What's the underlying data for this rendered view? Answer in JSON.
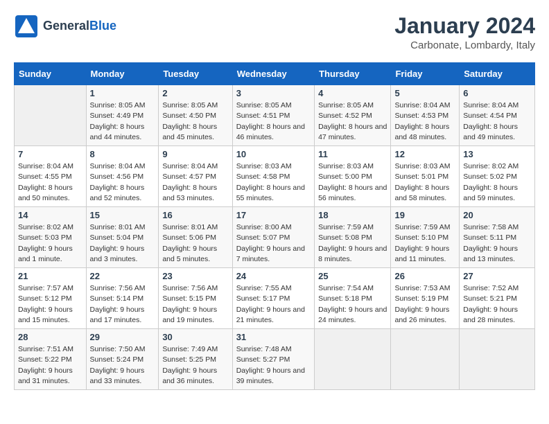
{
  "header": {
    "logo_general": "General",
    "logo_blue": "Blue",
    "month_title": "January 2024",
    "location": "Carbonate, Lombardy, Italy"
  },
  "days_of_week": [
    "Sunday",
    "Monday",
    "Tuesday",
    "Wednesday",
    "Thursday",
    "Friday",
    "Saturday"
  ],
  "weeks": [
    [
      {
        "day": "",
        "sunrise": "",
        "sunset": "",
        "daylight": ""
      },
      {
        "day": "1",
        "sunrise": "Sunrise: 8:05 AM",
        "sunset": "Sunset: 4:49 PM",
        "daylight": "Daylight: 8 hours and 44 minutes."
      },
      {
        "day": "2",
        "sunrise": "Sunrise: 8:05 AM",
        "sunset": "Sunset: 4:50 PM",
        "daylight": "Daylight: 8 hours and 45 minutes."
      },
      {
        "day": "3",
        "sunrise": "Sunrise: 8:05 AM",
        "sunset": "Sunset: 4:51 PM",
        "daylight": "Daylight: 8 hours and 46 minutes."
      },
      {
        "day": "4",
        "sunrise": "Sunrise: 8:05 AM",
        "sunset": "Sunset: 4:52 PM",
        "daylight": "Daylight: 8 hours and 47 minutes."
      },
      {
        "day": "5",
        "sunrise": "Sunrise: 8:04 AM",
        "sunset": "Sunset: 4:53 PM",
        "daylight": "Daylight: 8 hours and 48 minutes."
      },
      {
        "day": "6",
        "sunrise": "Sunrise: 8:04 AM",
        "sunset": "Sunset: 4:54 PM",
        "daylight": "Daylight: 8 hours and 49 minutes."
      }
    ],
    [
      {
        "day": "7",
        "sunrise": "Sunrise: 8:04 AM",
        "sunset": "Sunset: 4:55 PM",
        "daylight": "Daylight: 8 hours and 50 minutes."
      },
      {
        "day": "8",
        "sunrise": "Sunrise: 8:04 AM",
        "sunset": "Sunset: 4:56 PM",
        "daylight": "Daylight: 8 hours and 52 minutes."
      },
      {
        "day": "9",
        "sunrise": "Sunrise: 8:04 AM",
        "sunset": "Sunset: 4:57 PM",
        "daylight": "Daylight: 8 hours and 53 minutes."
      },
      {
        "day": "10",
        "sunrise": "Sunrise: 8:03 AM",
        "sunset": "Sunset: 4:58 PM",
        "daylight": "Daylight: 8 hours and 55 minutes."
      },
      {
        "day": "11",
        "sunrise": "Sunrise: 8:03 AM",
        "sunset": "Sunset: 5:00 PM",
        "daylight": "Daylight: 8 hours and 56 minutes."
      },
      {
        "day": "12",
        "sunrise": "Sunrise: 8:03 AM",
        "sunset": "Sunset: 5:01 PM",
        "daylight": "Daylight: 8 hours and 58 minutes."
      },
      {
        "day": "13",
        "sunrise": "Sunrise: 8:02 AM",
        "sunset": "Sunset: 5:02 PM",
        "daylight": "Daylight: 8 hours and 59 minutes."
      }
    ],
    [
      {
        "day": "14",
        "sunrise": "Sunrise: 8:02 AM",
        "sunset": "Sunset: 5:03 PM",
        "daylight": "Daylight: 9 hours and 1 minute."
      },
      {
        "day": "15",
        "sunrise": "Sunrise: 8:01 AM",
        "sunset": "Sunset: 5:04 PM",
        "daylight": "Daylight: 9 hours and 3 minutes."
      },
      {
        "day": "16",
        "sunrise": "Sunrise: 8:01 AM",
        "sunset": "Sunset: 5:06 PM",
        "daylight": "Daylight: 9 hours and 5 minutes."
      },
      {
        "day": "17",
        "sunrise": "Sunrise: 8:00 AM",
        "sunset": "Sunset: 5:07 PM",
        "daylight": "Daylight: 9 hours and 7 minutes."
      },
      {
        "day": "18",
        "sunrise": "Sunrise: 7:59 AM",
        "sunset": "Sunset: 5:08 PM",
        "daylight": "Daylight: 9 hours and 8 minutes."
      },
      {
        "day": "19",
        "sunrise": "Sunrise: 7:59 AM",
        "sunset": "Sunset: 5:10 PM",
        "daylight": "Daylight: 9 hours and 11 minutes."
      },
      {
        "day": "20",
        "sunrise": "Sunrise: 7:58 AM",
        "sunset": "Sunset: 5:11 PM",
        "daylight": "Daylight: 9 hours and 13 minutes."
      }
    ],
    [
      {
        "day": "21",
        "sunrise": "Sunrise: 7:57 AM",
        "sunset": "Sunset: 5:12 PM",
        "daylight": "Daylight: 9 hours and 15 minutes."
      },
      {
        "day": "22",
        "sunrise": "Sunrise: 7:56 AM",
        "sunset": "Sunset: 5:14 PM",
        "daylight": "Daylight: 9 hours and 17 minutes."
      },
      {
        "day": "23",
        "sunrise": "Sunrise: 7:56 AM",
        "sunset": "Sunset: 5:15 PM",
        "daylight": "Daylight: 9 hours and 19 minutes."
      },
      {
        "day": "24",
        "sunrise": "Sunrise: 7:55 AM",
        "sunset": "Sunset: 5:17 PM",
        "daylight": "Daylight: 9 hours and 21 minutes."
      },
      {
        "day": "25",
        "sunrise": "Sunrise: 7:54 AM",
        "sunset": "Sunset: 5:18 PM",
        "daylight": "Daylight: 9 hours and 24 minutes."
      },
      {
        "day": "26",
        "sunrise": "Sunrise: 7:53 AM",
        "sunset": "Sunset: 5:19 PM",
        "daylight": "Daylight: 9 hours and 26 minutes."
      },
      {
        "day": "27",
        "sunrise": "Sunrise: 7:52 AM",
        "sunset": "Sunset: 5:21 PM",
        "daylight": "Daylight: 9 hours and 28 minutes."
      }
    ],
    [
      {
        "day": "28",
        "sunrise": "Sunrise: 7:51 AM",
        "sunset": "Sunset: 5:22 PM",
        "daylight": "Daylight: 9 hours and 31 minutes."
      },
      {
        "day": "29",
        "sunrise": "Sunrise: 7:50 AM",
        "sunset": "Sunset: 5:24 PM",
        "daylight": "Daylight: 9 hours and 33 minutes."
      },
      {
        "day": "30",
        "sunrise": "Sunrise: 7:49 AM",
        "sunset": "Sunset: 5:25 PM",
        "daylight": "Daylight: 9 hours and 36 minutes."
      },
      {
        "day": "31",
        "sunrise": "Sunrise: 7:48 AM",
        "sunset": "Sunset: 5:27 PM",
        "daylight": "Daylight: 9 hours and 39 minutes."
      },
      {
        "day": "",
        "sunrise": "",
        "sunset": "",
        "daylight": ""
      },
      {
        "day": "",
        "sunrise": "",
        "sunset": "",
        "daylight": ""
      },
      {
        "day": "",
        "sunrise": "",
        "sunset": "",
        "daylight": ""
      }
    ]
  ]
}
